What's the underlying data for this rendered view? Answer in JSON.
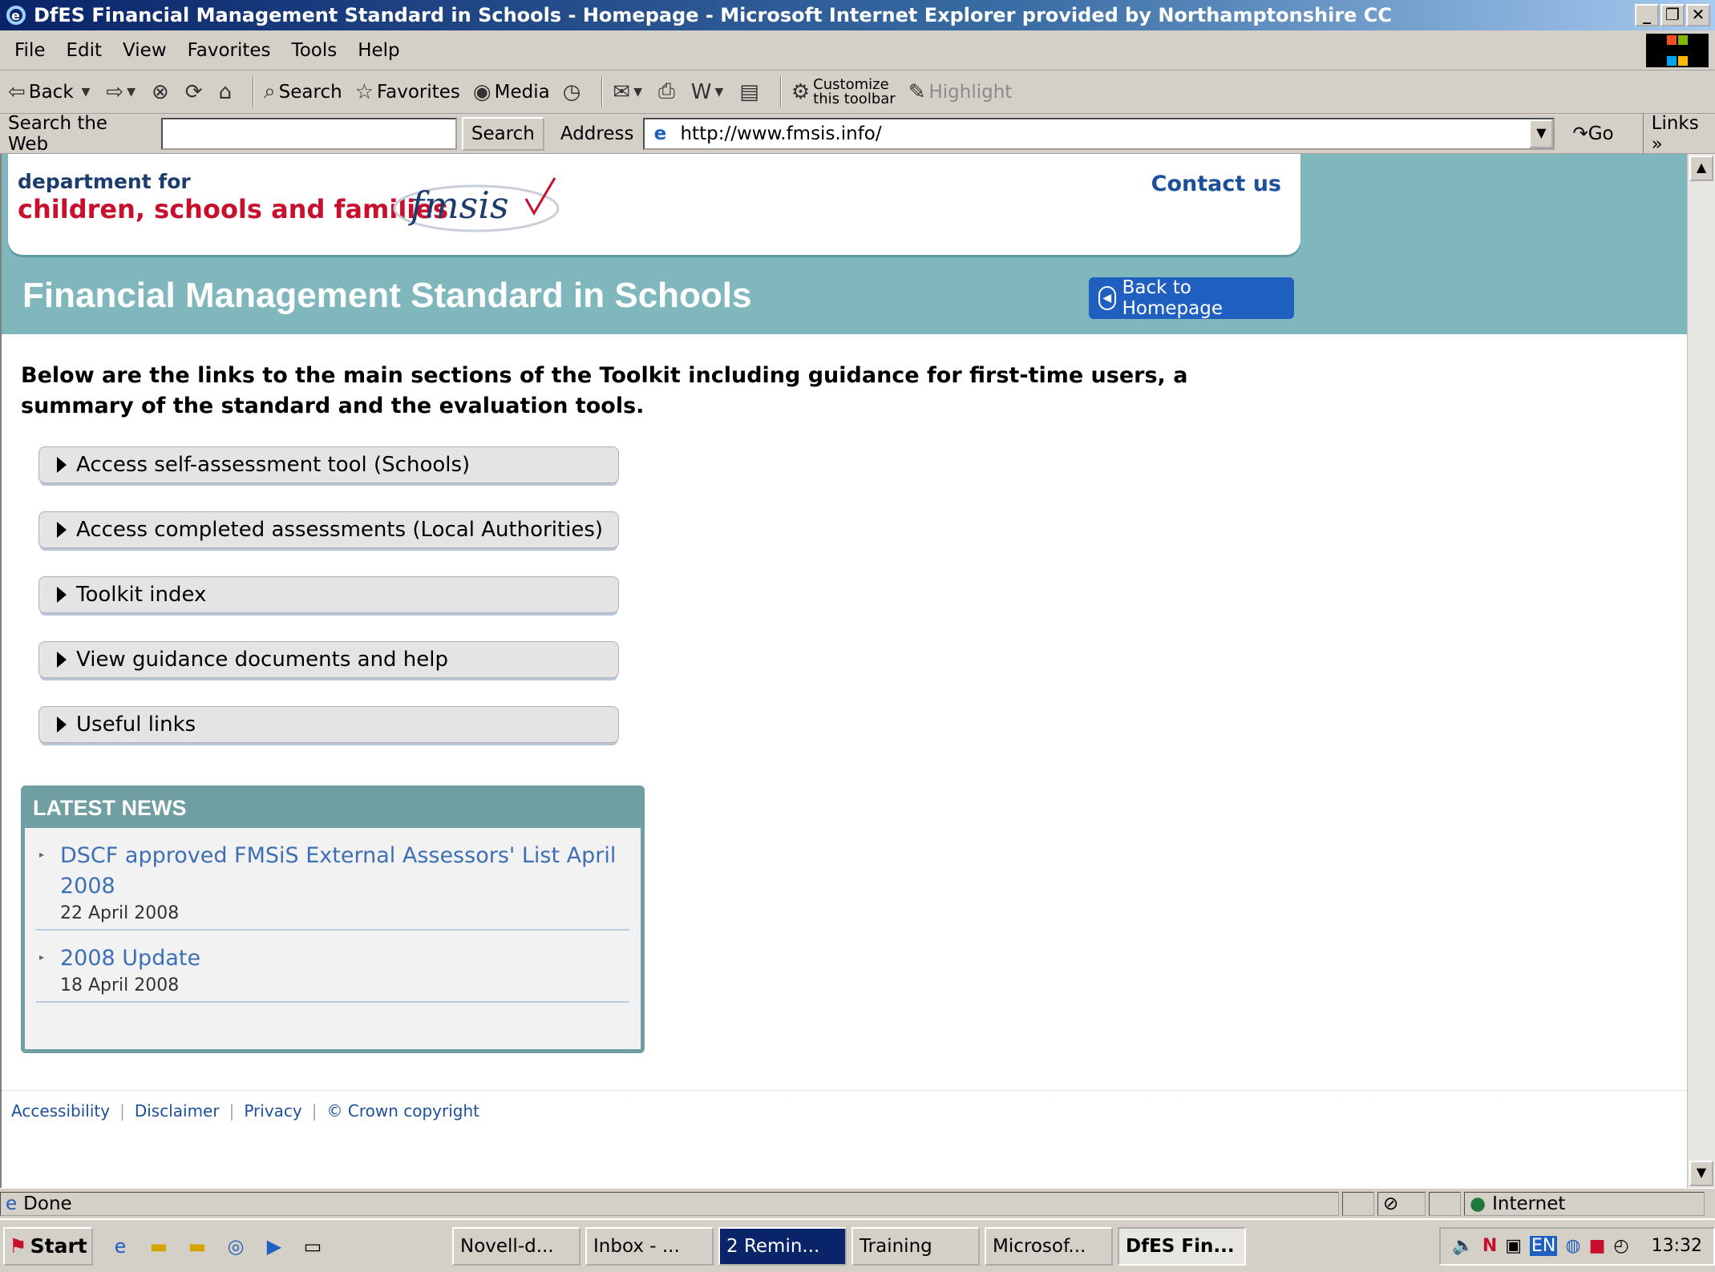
{
  "window": {
    "title": "DfES Financial Management Standard in Schools - Homepage - Microsoft Internet Explorer provided by Northamptonshire CC"
  },
  "menu": [
    "File",
    "Edit",
    "View",
    "Favorites",
    "Tools",
    "Help"
  ],
  "toolbar": {
    "back": "Back",
    "search": "Search",
    "favorites": "Favorites",
    "media": "Media",
    "customize_line1": "Customize",
    "customize_line2": "this toolbar",
    "highlight": "Highlight"
  },
  "addressbar": {
    "search_label": "Search the Web",
    "search_button": "Search",
    "address_label": "Address",
    "url": "http://www.fmsis.info/",
    "go": "Go",
    "links": "Links"
  },
  "page": {
    "dept_line1": "department for",
    "dept_line2": "children, schools and families",
    "logo_text": "fmsis",
    "contact": "Contact us",
    "title": "Financial Management Standard in Schools",
    "back_button": "Back to Homepage",
    "intro": "Below are the links to the main sections of the Toolkit including guidance for first-time users, a summary of the standard and the evaluation tools.",
    "nav": [
      "Access self-assessment tool (Schools)",
      "Access completed assessments (Local Authorities)",
      "Toolkit index",
      "View guidance documents and help",
      "Useful links"
    ],
    "news": {
      "heading": "LATEST NEWS",
      "items": [
        {
          "title": "DSCF approved FMSiS External Assessors' List April 2008",
          "date": "22 April 2008"
        },
        {
          "title": "2008 Update",
          "date": "18 April 2008"
        }
      ]
    },
    "footer": [
      "Accessibility",
      "Disclaimer",
      "Privacy",
      "© Crown copyright"
    ]
  },
  "status": {
    "text": "Done",
    "zone": "Internet"
  },
  "taskbar": {
    "start": "Start",
    "tasks": [
      "Novell-d...",
      "Inbox - ...",
      "2 Remin...",
      "Training",
      "Microsof...",
      "DfES Fin..."
    ],
    "tray_lang": "EN",
    "clock": "13:32"
  },
  "colors": {
    "header_band": "#7fb7bd",
    "link_blue": "#1c4f9c",
    "dept_red": "#c8102e",
    "button_blue": "#1f5fbf"
  }
}
